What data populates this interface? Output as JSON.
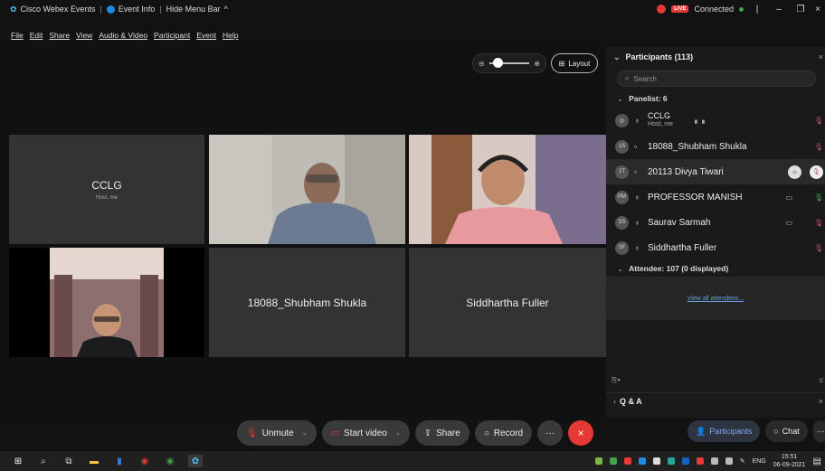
{
  "titlebar": {
    "app_title": "Cisco Webex Events",
    "event_info": "Event Info",
    "hide_menu": "Hide Menu Bar",
    "live_label": "LIVE",
    "connected": "Connected"
  },
  "menu": [
    "File",
    "Edit",
    "Share",
    "View",
    "Audio & Video",
    "Participant",
    "Event",
    "Help"
  ],
  "stage": {
    "layout_label": "Layout",
    "tiles": [
      {
        "name": "CCLG",
        "sub": "Host, me"
      },
      {
        "name": "18088_Shubham Shukla"
      },
      {
        "name": "Siddhartha Fuller"
      }
    ]
  },
  "controls": {
    "unmute": "Unmute",
    "start_video": "Start video",
    "share": "Share",
    "record": "Record",
    "participants": "Participants",
    "chat": "Chat"
  },
  "panel": {
    "title": "Participants (113)",
    "search_placeholder": "Search",
    "panelist_header": "Panelist: 6",
    "panelists": [
      {
        "initials": "",
        "name": "CCLG",
        "sub": "Host, me"
      },
      {
        "initials": "1S",
        "name": "18088_Shubham Shukla"
      },
      {
        "initials": "2T",
        "name": "20113 Divya Tiwari"
      },
      {
        "initials": "PM",
        "name": "PROFESSOR MANISH"
      },
      {
        "initials": "SS",
        "name": "Saurav Sarmah"
      },
      {
        "initials": "SF",
        "name": "Siddhartha Fuller"
      }
    ],
    "attendee_header": "Attendee: 107 (0 displayed)",
    "view_all": "View all attendees...",
    "qa": "Q & A"
  },
  "taskbar": {
    "lang": "ENG",
    "time": "15:51",
    "date": "06-09-2021"
  },
  "colors": {
    "accent_red": "#e53935",
    "panel_bg": "#1a1a1a",
    "link": "#6aa0e0"
  }
}
